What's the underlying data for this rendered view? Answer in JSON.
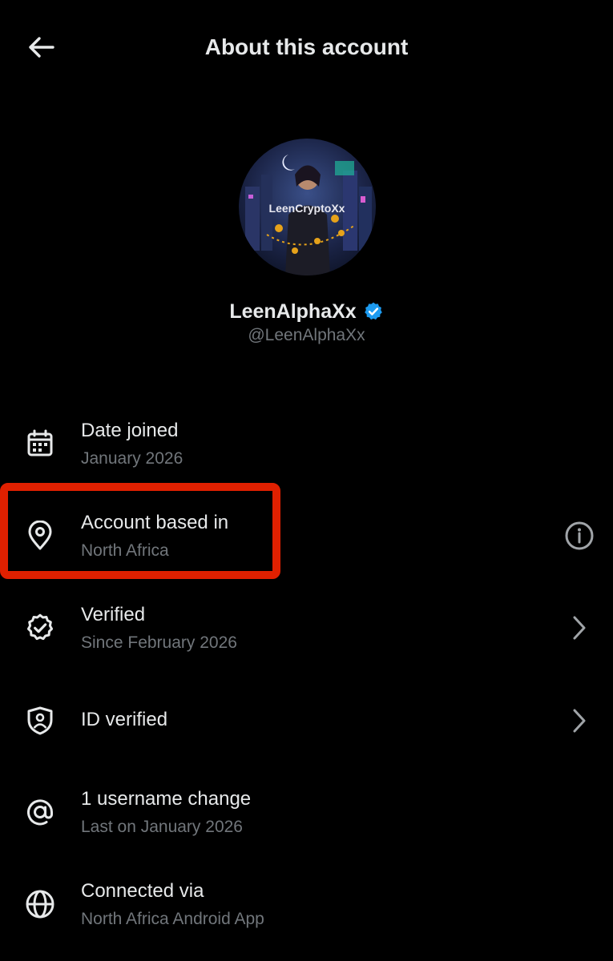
{
  "header": {
    "title": "About this account"
  },
  "profile": {
    "display_name": "LeenAlphaXx",
    "handle": "@LeenAlphaXx",
    "verified_badge_color": "#1d9bf0",
    "avatar_text": "LeenCryptoXx"
  },
  "rows": [
    {
      "title": "Date joined",
      "subtitle": "January 2026",
      "icon": "calendar-icon"
    },
    {
      "title": "Account based in",
      "subtitle": "North Africa",
      "icon": "location-pin-icon",
      "trailing": "info-icon"
    },
    {
      "title": "Verified",
      "subtitle": "Since February 2026",
      "icon": "verified-badge-icon",
      "trailing": "chevron-right-icon"
    },
    {
      "title": "ID verified",
      "subtitle": "",
      "icon": "shield-person-icon",
      "trailing": "chevron-right-icon"
    },
    {
      "title": "1 username change",
      "subtitle": "Last on January 2026",
      "icon": "at-sign-icon"
    },
    {
      "title": "Connected via",
      "subtitle": "North Africa Android App",
      "icon": "globe-icon"
    }
  ],
  "colors": {
    "background": "#000000",
    "primary_text": "#e7e9ea",
    "secondary_text": "#71767b",
    "highlight_box": "#e02000"
  }
}
